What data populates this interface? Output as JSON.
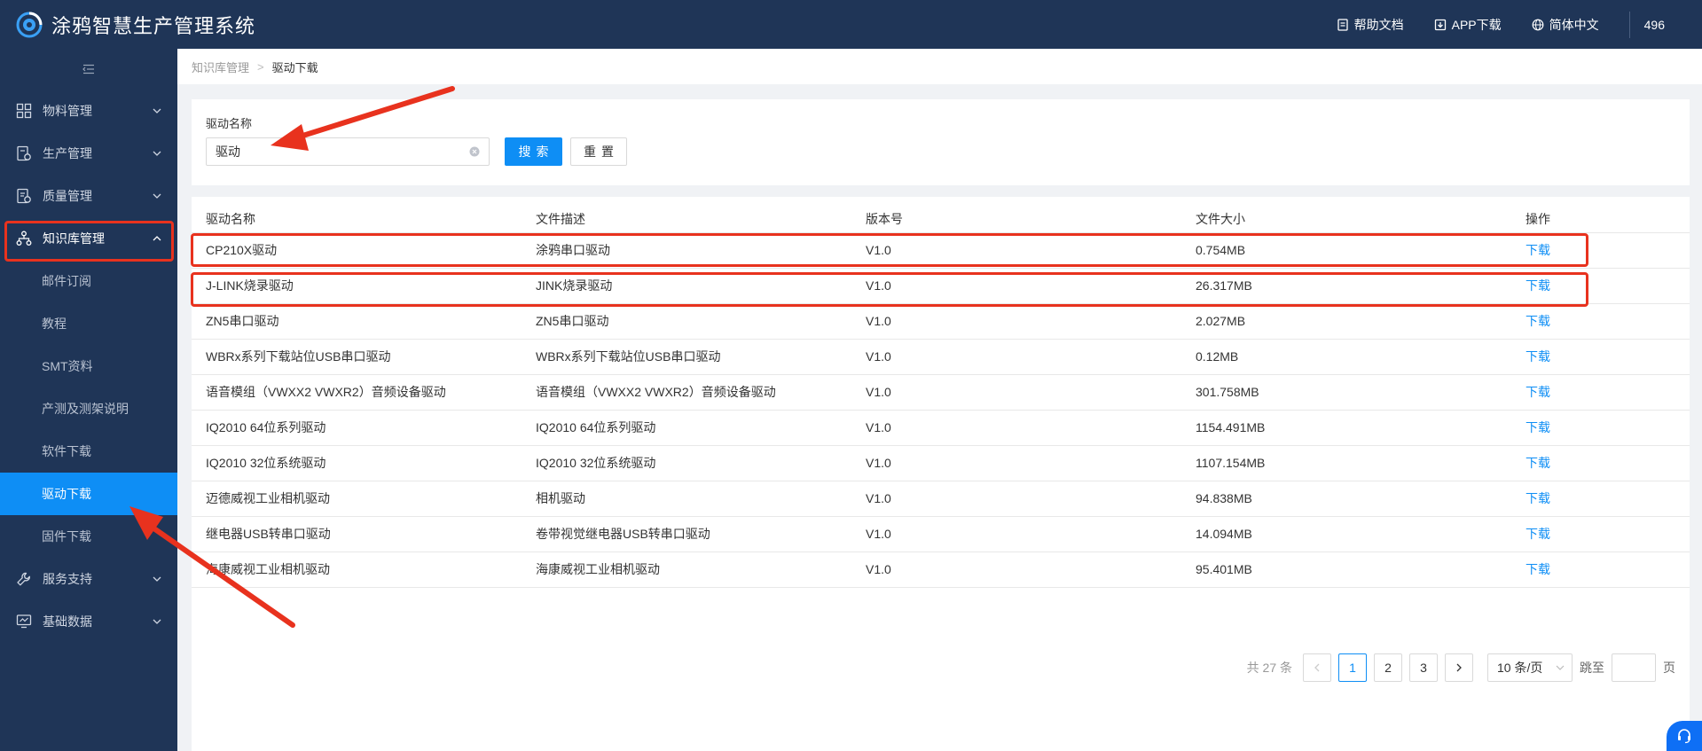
{
  "header": {
    "title": "涂鸦智慧生产管理系统",
    "links": [
      {
        "label": "帮助文档",
        "icon": "document-icon"
      },
      {
        "label": "APP下载",
        "icon": "download-icon"
      },
      {
        "label": "简体中文",
        "icon": "globe-icon"
      }
    ],
    "user": "496"
  },
  "sidebar": {
    "menus": [
      {
        "label": "物料管理",
        "icon": "grid-icon"
      },
      {
        "label": "生产管理",
        "icon": "production-icon"
      },
      {
        "label": "质量管理",
        "icon": "quality-icon"
      },
      {
        "label": "知识库管理",
        "icon": "org-icon"
      },
      {
        "label": "服务支持",
        "icon": "wrench-icon"
      },
      {
        "label": "基础数据",
        "icon": "monitor-icon"
      }
    ],
    "submenus": [
      {
        "label": "邮件订阅"
      },
      {
        "label": "教程"
      },
      {
        "label": "SMT资料"
      },
      {
        "label": "产测及测架说明"
      },
      {
        "label": "软件下载"
      },
      {
        "label": "驱动下载"
      },
      {
        "label": "固件下载"
      }
    ],
    "active_submenu": "驱动下载",
    "colors": {
      "bg": "#1f3557",
      "active": "#0e8ef5"
    }
  },
  "breadcrumb": {
    "parent": "知识库管理",
    "separator": ">",
    "current": "驱动下载"
  },
  "search": {
    "label": "驱动名称",
    "value": "驱动",
    "search_button": "搜索",
    "reset_button": "重置"
  },
  "table": {
    "columns": [
      "驱动名称",
      "文件描述",
      "版本号",
      "文件大小",
      "操作"
    ],
    "rows": [
      {
        "name": "CP210X驱动",
        "desc": "涂鸦串口驱动",
        "version": "V1.0",
        "size": "0.754MB",
        "action": "下载"
      },
      {
        "name": "J-LINK烧录驱动",
        "desc": "JINK烧录驱动",
        "version": "V1.0",
        "size": "26.317MB",
        "action": "下载"
      },
      {
        "name": "ZN5串口驱动",
        "desc": "ZN5串口驱动",
        "version": "V1.0",
        "size": "2.027MB",
        "action": "下载"
      },
      {
        "name": "WBRx系列下载站位USB串口驱动",
        "desc": "WBRx系列下载站位USB串口驱动",
        "version": "V1.0",
        "size": "0.12MB",
        "action": "下载"
      },
      {
        "name": "语音模组（VWXX2 VWXR2）音频设备驱动",
        "desc": "语音模组（VWXX2 VWXR2）音频设备驱动",
        "version": "V1.0",
        "size": "301.758MB",
        "action": "下载"
      },
      {
        "name": "IQ2010 64位系列驱动",
        "desc": "IQ2010 64位系列驱动",
        "version": "V1.0",
        "size": "1154.491MB",
        "action": "下载"
      },
      {
        "name": "IQ2010 32位系统驱动",
        "desc": "IQ2010 32位系统驱动",
        "version": "V1.0",
        "size": "1107.154MB",
        "action": "下载"
      },
      {
        "name": "迈德威视工业相机驱动",
        "desc": "相机驱动",
        "version": "V1.0",
        "size": "94.838MB",
        "action": "下载"
      },
      {
        "name": "继电器USB转串口驱动",
        "desc": "卷带视觉继电器USB转串口驱动",
        "version": "V1.0",
        "size": "14.094MB",
        "action": "下载"
      },
      {
        "name": "海康威视工业相机驱动",
        "desc": "海康威视工业相机驱动",
        "version": "V1.0",
        "size": "95.401MB",
        "action": "下载"
      }
    ]
  },
  "pagination": {
    "total": "共 27 条",
    "pages": [
      "1",
      "2",
      "3"
    ],
    "current": "1",
    "page_size": "10 条/页",
    "jump_label": "跳至",
    "page_suffix": "页"
  },
  "annotation_color": "#e8321e"
}
